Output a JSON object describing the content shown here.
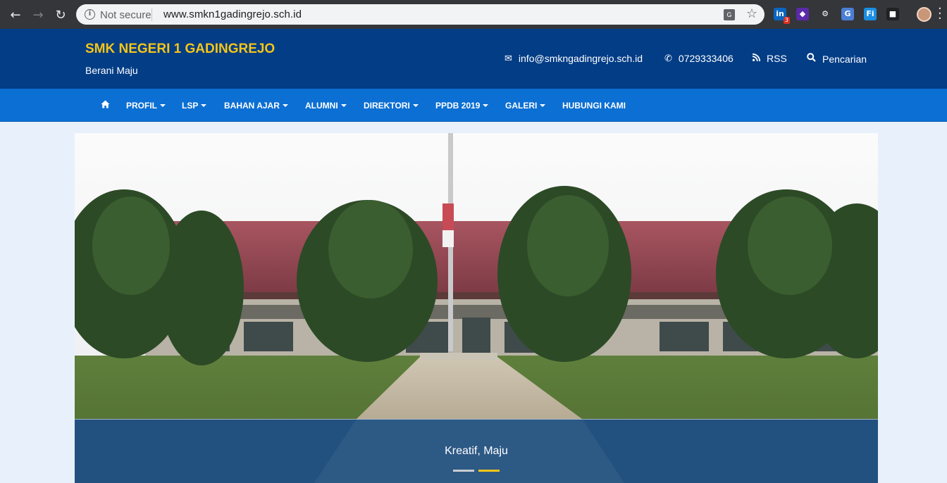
{
  "browser": {
    "security_label": "Not secure",
    "url": "www.smkn1gadingrejo.sch.id",
    "extensions": [
      {
        "name": "linkedin-extension",
        "glyph": "in",
        "color": "#0a66c2",
        "badge": "3"
      },
      {
        "name": "purple-extension",
        "glyph": "◆",
        "color": "#5b2aa9"
      },
      {
        "name": "gear-extension",
        "glyph": "⚙",
        "color": "#35363a"
      },
      {
        "name": "translate-extension",
        "glyph": "G",
        "color": "#4a7fd6"
      },
      {
        "name": "fi-extension",
        "glyph": "Fi",
        "color": "#1a8fe3"
      },
      {
        "name": "cube-extension",
        "glyph": "■",
        "color": "#202124"
      }
    ]
  },
  "site": {
    "title": "SMK NEGERI 1 GADINGREJO",
    "tagline": "Berani Maju",
    "contacts": {
      "email": "info@smkngadingrejo.sch.id",
      "phone": "0729333406",
      "rss": "RSS",
      "search": "Pencarian"
    },
    "colors": {
      "header": "#033d86",
      "nav": "#0c6fd3",
      "title": "#f5c518"
    }
  },
  "nav": {
    "items": [
      {
        "label": "PROFIL",
        "dropdown": true
      },
      {
        "label": "LSP",
        "dropdown": true
      },
      {
        "label": "BAHAN AJAR",
        "dropdown": true
      },
      {
        "label": "ALUMNI",
        "dropdown": true
      },
      {
        "label": "DIREKTORI",
        "dropdown": true
      },
      {
        "label": "PPDB 2019",
        "dropdown": true
      },
      {
        "label": "GALERI",
        "dropdown": true
      },
      {
        "label": "HUBUNGI KAMI",
        "dropdown": false
      }
    ]
  },
  "slider": {
    "caption": "Kreatif, Maju",
    "slide_count": 2,
    "active_index": 1,
    "indicator_colors": {
      "inactive": "#c9ccd2",
      "active": "#f5c518"
    }
  }
}
